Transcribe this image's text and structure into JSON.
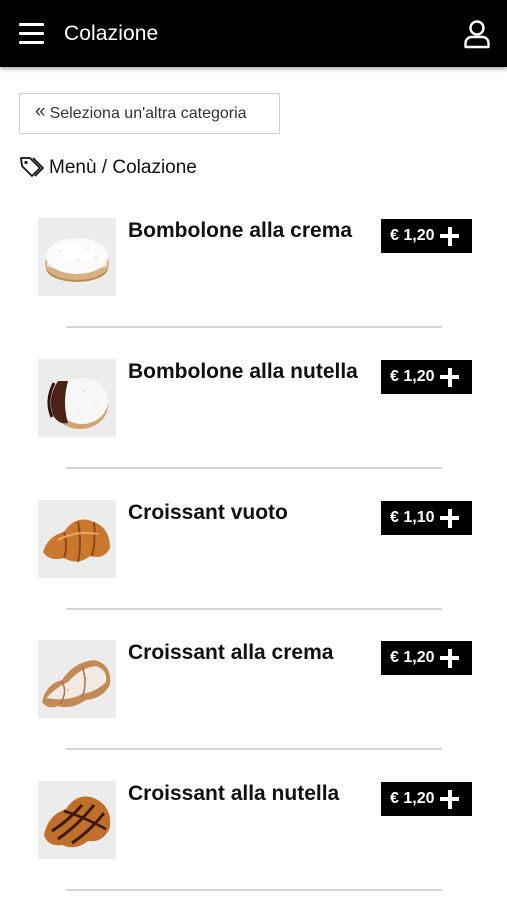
{
  "header": {
    "title": "Colazione"
  },
  "back_button": {
    "label": "Seleziona un'altra categoria"
  },
  "breadcrumb": {
    "text": "Menù / Colazione"
  },
  "items": [
    {
      "name": "Bombolone alla crema",
      "price": "€ 1,20",
      "image": "bombolone-crema"
    },
    {
      "name": "Bombolone alla nutella",
      "price": "€ 1,20",
      "image": "bombolone-nutella"
    },
    {
      "name": "Croissant vuoto",
      "price": "€ 1,10",
      "image": "croissant-vuoto"
    },
    {
      "name": "Croissant alla crema",
      "price": "€ 1,20",
      "image": "croissant-crema"
    },
    {
      "name": "Croissant alla nutella",
      "price": "€ 1,20",
      "image": "croissant-nutella"
    }
  ]
}
